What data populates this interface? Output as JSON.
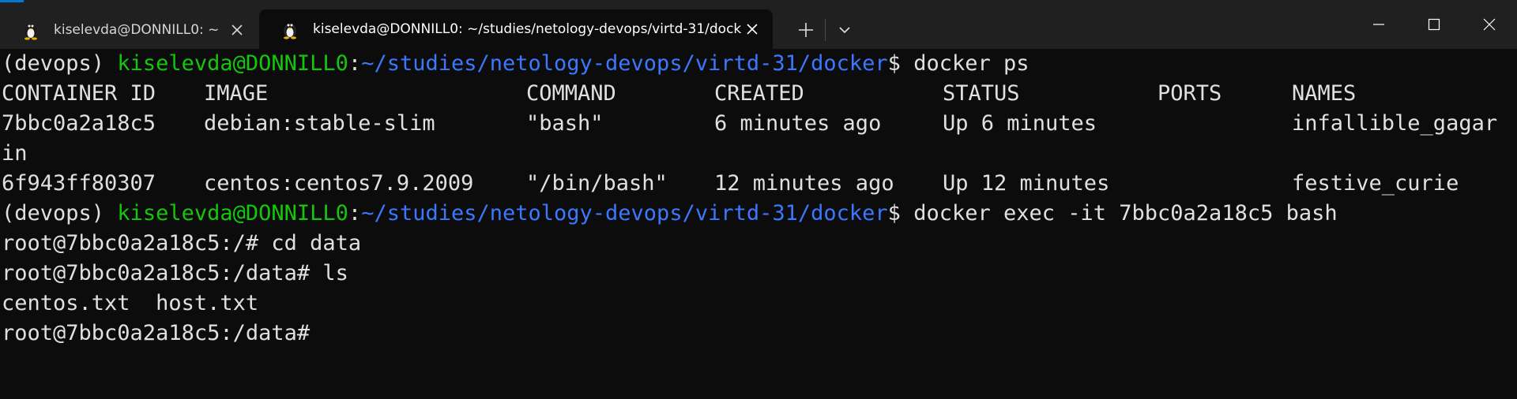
{
  "tabs": [
    {
      "title": "kiselevda@DONNILL0: ~",
      "icon": "tux-penguin-icon"
    },
    {
      "title": "kiselevda@DONNILL0: ~/studies/netology-devops/virtd-31/docker",
      "icon": "tux-penguin-icon"
    }
  ],
  "toolbar": {
    "new_tab_icon": "plus-icon",
    "dropdown_icon": "chevron-down-icon"
  },
  "window_controls": [
    "minimize-icon",
    "maximize-icon",
    "close-icon"
  ],
  "colors": {
    "titlebar": "#202020",
    "terminal_bg": "#0c0c0c",
    "prompt_user": "#16c60c",
    "prompt_path": "#3b78ff",
    "text": "#e0e0e0",
    "accent": "#0078d4"
  },
  "prompt": {
    "env": "(devops) ",
    "user_host": "kiselevda@DONNILL0",
    "colon": ":",
    "path": "~/studies/netology-devops/virtd-31/docker",
    "dollar": "$ "
  },
  "commands": {
    "first": "docker ps",
    "second": "docker exec -it 7bbc0a2a18c5 bash"
  },
  "docker_ps": {
    "headers": [
      "CONTAINER ID",
      "IMAGE",
      "COMMAND",
      "CREATED",
      "STATUS",
      "PORTS",
      "NAMES"
    ],
    "rows": [
      [
        "7bbc0a2a18c5",
        "debian:stable-slim",
        "\"bash\"",
        "6 minutes ago",
        "Up 6 minutes",
        "",
        "infallible_gagar"
      ],
      [
        "6f943ff80307",
        "centos:centos7.9.2009",
        "\"/bin/bash\"",
        "12 minutes ago",
        "Up 12 minutes",
        "",
        "festive_curie"
      ]
    ],
    "wrap_continuation": "in"
  },
  "container_session": [
    "root@7bbc0a2a18c5:/# cd data",
    "root@7bbc0a2a18c5:/data# ls",
    "centos.txt  host.txt",
    "root@7bbc0a2a18c5:/data# "
  ]
}
